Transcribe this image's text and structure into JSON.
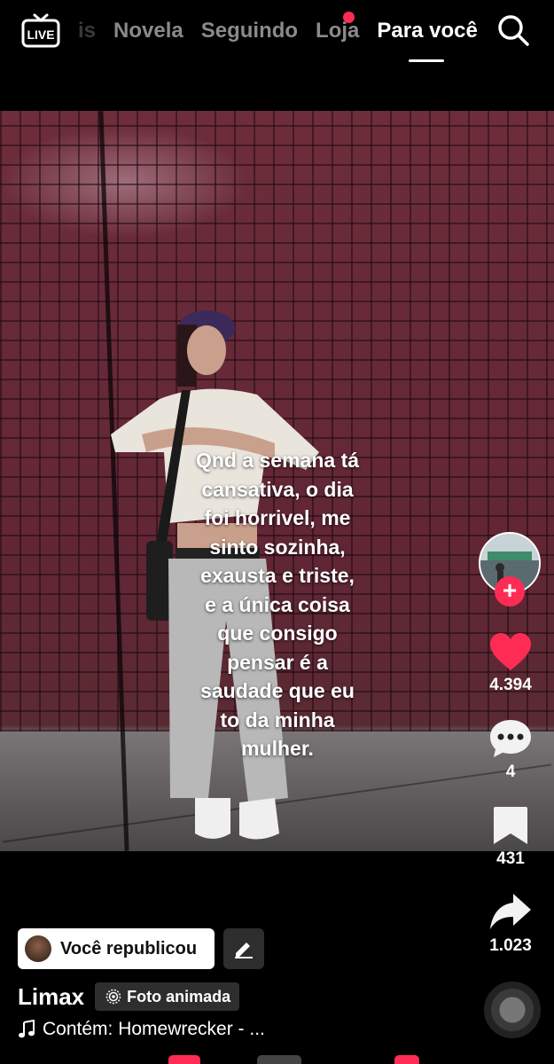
{
  "header": {
    "tabs": [
      {
        "label": "is",
        "state": "partial"
      },
      {
        "label": "Novela",
        "state": "inactive"
      },
      {
        "label": "Seguindo",
        "state": "inactive"
      },
      {
        "label": "Loja",
        "state": "inactive",
        "notification_dot": true
      },
      {
        "label": "Para você",
        "state": "active"
      }
    ],
    "icons": {
      "live": "live-tv-icon",
      "search": "search-icon"
    }
  },
  "post": {
    "caption": "Qnd a semana tá\ncansativa, o dia\nfoi horrivel, me\nsinto sozinha,\nexausta e triste,\ne a única coisa\nque consigo\npensar é a\nsaudade que eu\nto da minha\nmulher.",
    "author": "Limax",
    "format_badge": "Foto animada",
    "repost_label": "Você republicou",
    "music": "Contém: Homewrecker - ..."
  },
  "actions": {
    "likes": "4.394",
    "comments": "4",
    "saves": "431",
    "shares": "1.023"
  },
  "colors": {
    "accent": "#fe2c55",
    "background": "#000000",
    "panel": "#2e2e2e"
  }
}
